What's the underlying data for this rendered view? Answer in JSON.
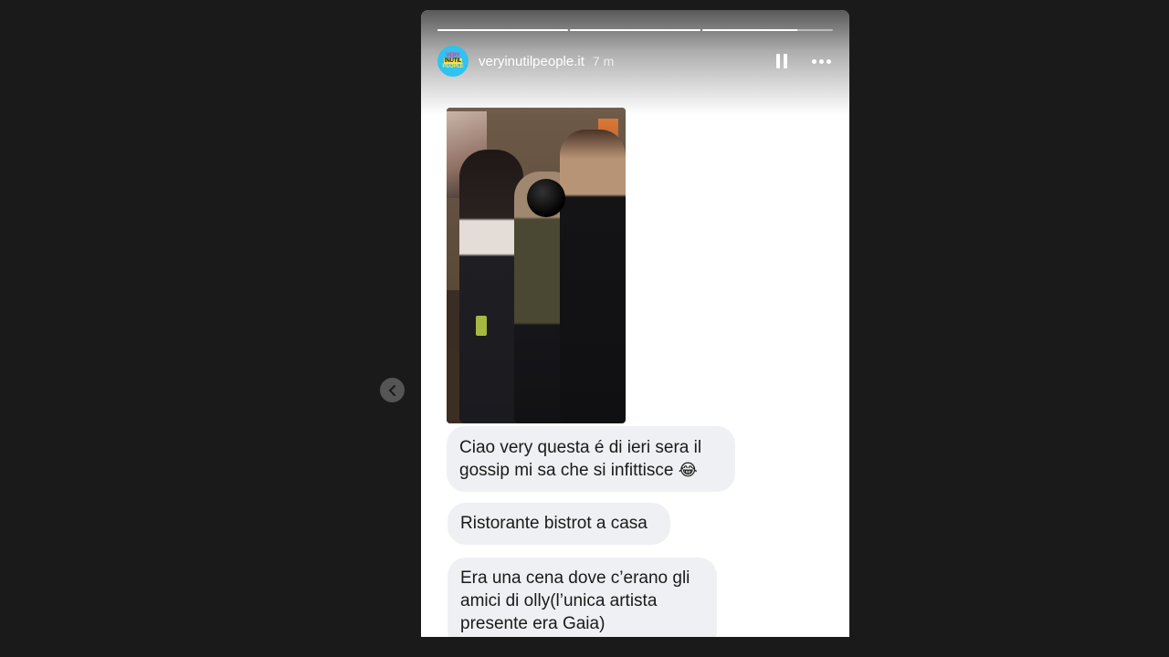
{
  "story": {
    "username": "veryinutilpeople.it",
    "time_ago": "7 m",
    "avatar_text": [
      "VERY",
      "INUTIL",
      "PEOPLE"
    ],
    "progress_segments": [
      1.0,
      1.0,
      0.73
    ]
  },
  "controls": {
    "pause_icon": "pause-icon",
    "more_icon": "more-options-icon",
    "prev_icon": "chevron-left-icon"
  },
  "messages": {
    "message1_text": "Ciao very questa é di ieri sera il gossip mi sa che si infittisce",
    "message1_emoji": "😂",
    "message2_text": "Ristorante bistrot a casa",
    "message3_text": "Era una cena dove c’erano gli amici di olly(l’unica artista presente era Gaia)"
  },
  "colors": {
    "background": "#1a1a1a",
    "bubble": "#eef0f3",
    "text": "#1a1a1a",
    "avatar_bg": "#2ec3f0"
  }
}
